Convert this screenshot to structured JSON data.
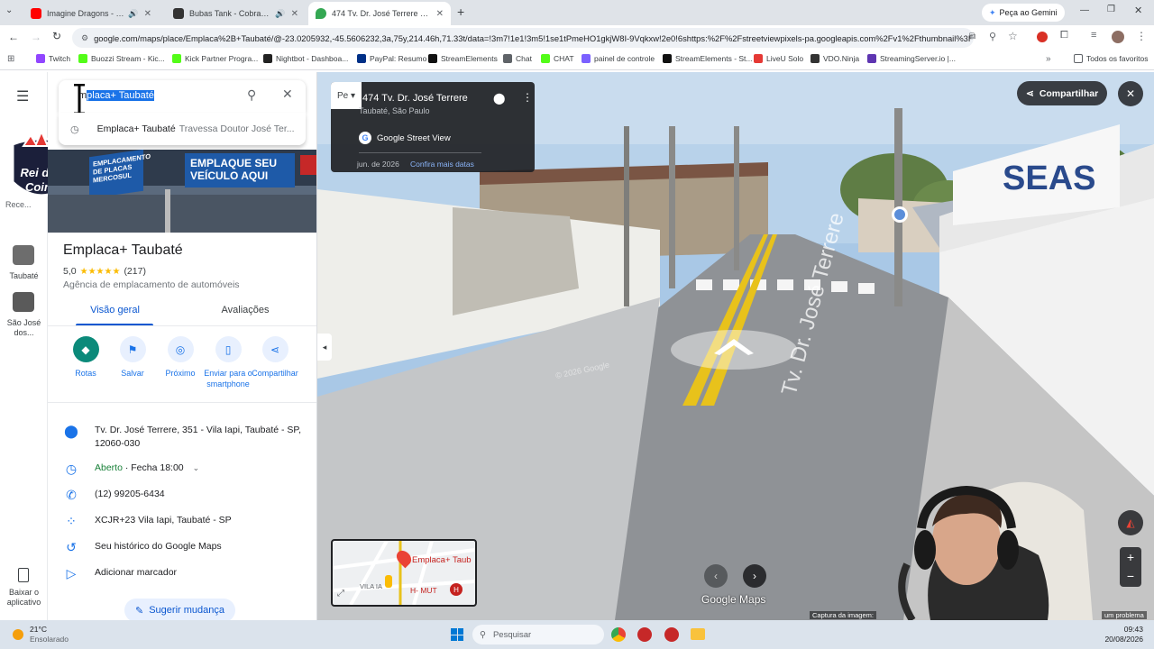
{
  "tabs": [
    {
      "title": "Imagine Dragons - Believer",
      "color": "#ff0000"
    },
    {
      "title": "Bubas Tank - Cobras — Bai",
      "color": "#333333"
    },
    {
      "title": "474 Tv. Dr. José Terrere - Goog",
      "color": "#34a853"
    }
  ],
  "tab_new": "+",
  "gemini_label": "Peça ao Gemini",
  "url": "google.com/maps/place/Emplaca%2B+Taubaté/@-23.0205932,-45.5606232,3a,75y,214.46h,71.33t/data=!3m7!1e1!3m5!1se1tPmeHO1gkjW8I-9Vqkxw!2e0!6shttps:%2F%2Fstreetviewpixels-pa.googleapis.com%2Fv1%2Fthumbnail%3F...",
  "bookmarks": [
    "Twitch",
    "Buozzi Stream - Kic...",
    "Kick Partner Progra...",
    "Nightbot - Dashboa...",
    "PayPal: Resumo",
    "StreamElements",
    "Chat",
    "CHAT",
    "painel de controle",
    "StreamElements - St...",
    "LiveU Solo",
    "VDO.Ninja",
    "StreamingServer.io |..."
  ],
  "bookmarks_all": "Todos os favoritos",
  "rail": {
    "recent": "Rece...",
    "item1": "Taubaté",
    "item2": "São José dos...",
    "download": "Baixar o aplicativo"
  },
  "search": {
    "value": "Emplaca+ Taubaté",
    "selected": "placa+ Taubaté",
    "prefix": "m",
    "suggestion_name": "Emplaca+ Taubaté",
    "suggestion_addr": "Travessa Doutor José Ter..."
  },
  "logo_text": "Rei dos Coins",
  "banner_left": "EMPLACAMENTO DE PLACAS MERCOSUL",
  "banner_right": "EMPLAQUE SEU VEÍCULO AQUI",
  "place": {
    "name": "Emplaca+ Taubaté",
    "rating": "5,0",
    "stars": "★★★★★",
    "reviews": "(217)",
    "category": "Agência de emplacamento de automóveis"
  },
  "place_tabs": {
    "overview": "Visão geral",
    "reviews": "Avaliações"
  },
  "actions": [
    "Rotas",
    "Salvar",
    "Próximo",
    "Enviar para o smartphone",
    "Compartilhar"
  ],
  "info": {
    "address": "Tv. Dr. José Terrere, 351 - Vila Iapi, Taubaté - SP, 12060-030",
    "hours_open": "Aberto",
    "hours_close": " · Fecha 18:00",
    "phone": "(12) 99205-6434",
    "pluscode": "XCJR+23 Vila Iapi, Taubaté - SP",
    "history": "Seu histórico do Google Maps",
    "label": "Adicionar marcador"
  },
  "suggest": "Sugerir mudança",
  "sv": {
    "title": "474 Tv. Dr. José Terrere",
    "subtitle": "Taubaté, São Paulo",
    "brand": "Google Street View",
    "date": "jun. de 2026",
    "more_dates": "Confira mais datas",
    "share": "Compartilhar",
    "minimap_label": "Emplaca+ Taub",
    "minimap_area": "VILA IA",
    "minimap_hmut": "H- MUT",
    "google_maps": "Google Maps",
    "capture": "Captura da imagem:",
    "problem": "um problema",
    "street_text": "Tv. Dr. José Terrere",
    "seas": "SEAS",
    "watermark": "© 2026 Google"
  },
  "taskbar": {
    "temp": "21°C",
    "weather": "Ensolarado",
    "search": "Pesquisar",
    "time": "09:43",
    "date": "20/08/2026"
  }
}
